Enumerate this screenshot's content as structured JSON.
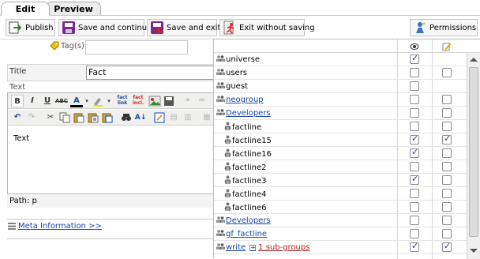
{
  "tabs": [
    {
      "label": "Edit"
    },
    {
      "label": "Preview"
    }
  ],
  "toolbar": {
    "publish": "Publish",
    "save_continue": "Save and continue",
    "save_exit": "Save and exit",
    "exit_no_save": "Exit without saving",
    "permissions": "Permissions"
  },
  "form": {
    "tags_label": "Tag(s):",
    "tags_value": "",
    "title_label": "Title",
    "title_value": "Fact",
    "text_label": "Text",
    "editor_text": "Text",
    "path": "Path: p",
    "meta_link": "Meta Information >>"
  },
  "editor_toolbar": {
    "bold": "B",
    "italic": "I",
    "underline": "U",
    "strike": "ABC",
    "font_color": "A",
    "fact_link": "fact link",
    "fact_incl": "fact incl."
  },
  "permissions": {
    "rows": [
      {
        "name": "universe",
        "link": false,
        "icon": "group-icon",
        "view": true,
        "edit": null
      },
      {
        "name": "users",
        "link": false,
        "icon": "group-icon",
        "view": false,
        "edit": false
      },
      {
        "name": "guest",
        "link": false,
        "icon": "group-icon",
        "view": false,
        "edit": null
      },
      {
        "name": "neogroup",
        "link": true,
        "icon": "group-icon",
        "view": false,
        "edit": false
      },
      {
        "name": "Developers",
        "link": true,
        "icon": "group-icon",
        "view": false,
        "edit": false
      },
      {
        "name": "factline",
        "link": false,
        "icon": "user-icon",
        "view": false,
        "edit": false
      },
      {
        "name": "factline15",
        "link": false,
        "icon": "user-icon",
        "view": true,
        "edit": true
      },
      {
        "name": "factline16",
        "link": false,
        "icon": "user-icon",
        "view": true,
        "edit": false
      },
      {
        "name": "factline2",
        "link": false,
        "icon": "user-icon",
        "view": false,
        "edit": false
      },
      {
        "name": "factline3",
        "link": false,
        "icon": "user-icon",
        "view": true,
        "edit": false
      },
      {
        "name": "factline4",
        "link": false,
        "icon": "user-icon",
        "view": false,
        "edit": false
      },
      {
        "name": "factline6",
        "link": false,
        "icon": "user-icon",
        "view": false,
        "edit": false
      },
      {
        "name": "Developers",
        "link": true,
        "icon": "group-icon",
        "view": false,
        "edit": false
      },
      {
        "name": "gf_factline",
        "link": true,
        "icon": "group-icon",
        "view": false,
        "edit": false
      },
      {
        "name": "write",
        "link": true,
        "icon": "group-icon",
        "view": true,
        "edit": true,
        "sub": "1 sub-groups"
      }
    ]
  },
  "colors": {
    "link": "#1a44a8",
    "check": "#2a3a8a"
  }
}
